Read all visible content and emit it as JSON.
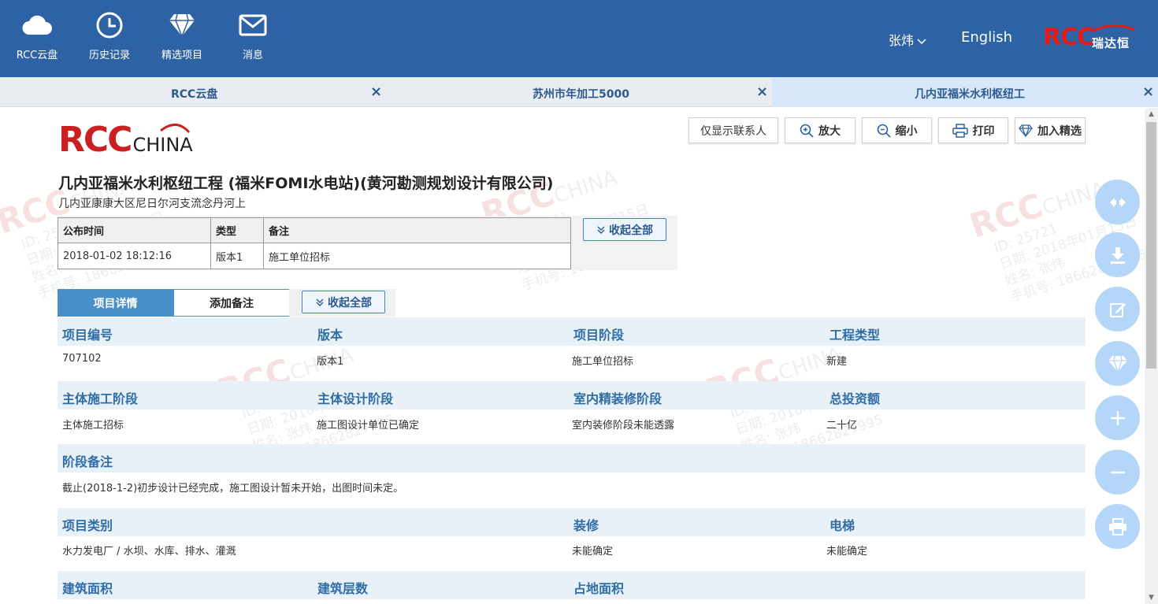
{
  "nav": {
    "items": [
      {
        "label": "RCC云盘",
        "icon": "cloud-icon"
      },
      {
        "label": "历史记录",
        "icon": "clock-icon"
      },
      {
        "label": "精选项目",
        "icon": "diamond-icon"
      },
      {
        "label": "消息",
        "icon": "mail-icon"
      }
    ],
    "user": "张炜",
    "language": "English",
    "brand_rcc": "RCC",
    "brand_cn": "瑞达恒"
  },
  "tabs": [
    {
      "label": "RCC云盘",
      "close": "×"
    },
    {
      "label": "苏州市年加工5000",
      "close": "×"
    },
    {
      "label": "几内亚福米水利枢纽工",
      "close": "×"
    }
  ],
  "logo": {
    "rcc": "RCC",
    "china": "CHINA"
  },
  "toolbar": {
    "contacts_only": "仅显示联系人",
    "zoom_in": "放大",
    "zoom_out": "缩小",
    "print": "打印",
    "add_featured": "加入精选"
  },
  "project": {
    "title": "几内亚福米水利枢纽工程 (福米FOMI水电站)(黄河勘测规划设计有限公司)",
    "location": "几内亚康康大区尼日尔河支流念丹河上"
  },
  "publish_table": {
    "headers": [
      "公布时间",
      "类型",
      "备注"
    ],
    "row": [
      "2018-01-02 18:12:16",
      "版本1",
      "施工单位招标"
    ],
    "collapse_all": "收起全部"
  },
  "detail_tabs": {
    "details": "项目详情",
    "add_note": "添加备注",
    "collapse_all": "收起全部"
  },
  "details": {
    "row1_labels": [
      "项目编号",
      "版本",
      "项目阶段",
      "工程类型"
    ],
    "row1_values": [
      "707102",
      "版本1",
      "施工单位招标",
      "新建"
    ],
    "row2_labels": [
      "主体施工阶段",
      "主体设计阶段",
      "室内精装修阶段",
      "总投资额"
    ],
    "row2_values": [
      "主体施工招标",
      "施工图设计单位已确定",
      "室内装修阶段未能透露",
      "二十亿"
    ],
    "stage_note_label": "阶段备注",
    "stage_note_value": "截止(2018-1-2)初步设计已经完成，施工图设计暂未开始，出图时间未定。",
    "row4_labels": [
      "项目类别",
      "装修",
      "电梯"
    ],
    "row4_values": [
      "水力发电厂 / 水坝、水库、排水、灌溉",
      "未能确定",
      "未能确定"
    ],
    "row5_labels": [
      "建筑面积",
      "建筑层数",
      "占地面积"
    ]
  },
  "watermark": {
    "logo": "RCC",
    "logo_suffix": "CHINA",
    "id_line": "ID: 25721",
    "date_line": "日期: 2018年01月15日",
    "name_line": "姓名: 张炜",
    "phone_line": "手机号: 18662827995"
  },
  "fabs": [
    "share-icon",
    "download-icon",
    "edit-icon",
    "diamond-icon",
    "plus-icon",
    "minus-icon",
    "print-icon"
  ],
  "colors": {
    "header": "#2d63a4",
    "accent": "#4a90c8",
    "brand_red": "#e21b1b",
    "label_blue": "#2f6da6",
    "fab": "#b4d6f8"
  }
}
